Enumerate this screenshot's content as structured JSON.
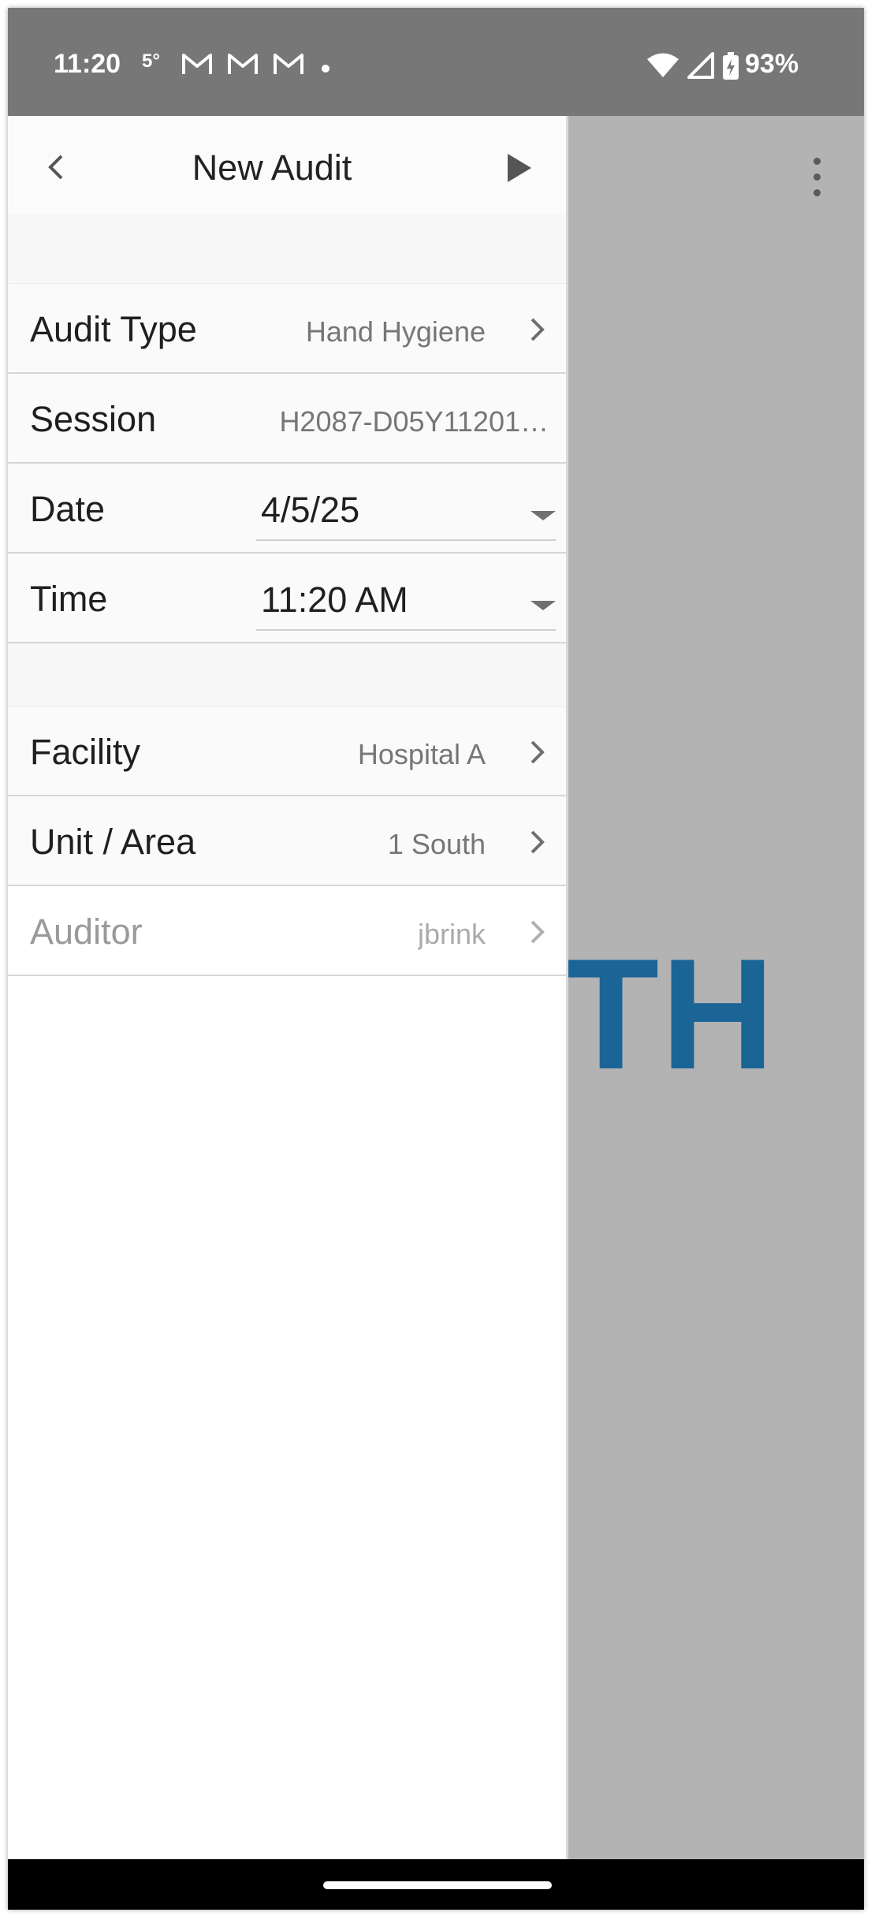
{
  "status_bar": {
    "time": "11:20",
    "temperature": "5°",
    "notification_icons": [
      "gmail-icon",
      "gmail-icon",
      "gmail-icon"
    ],
    "right_icons": [
      "wifi-icon",
      "signal-icon",
      "battery-charging-icon"
    ],
    "battery_percent": "93%"
  },
  "background": {
    "text": "TH",
    "text_color": "#1a6496",
    "menu_icon": "overflow-menu-icon"
  },
  "panel": {
    "title": "New Audit",
    "back_icon": "chevron-left-icon",
    "next_icon": "play-icon",
    "rows": {
      "audit_type": {
        "label": "Audit Type",
        "value": "Hand Hygiene"
      },
      "session": {
        "label": "Session",
        "value": "H2087-D05Y11201…"
      },
      "date": {
        "label": "Date",
        "value": "4/5/25"
      },
      "time": {
        "label": "Time",
        "value": "11:20 AM"
      },
      "facility": {
        "label": "Facility",
        "value": "Hospital A"
      },
      "unit_area": {
        "label": "Unit / Area",
        "value": "1 South"
      },
      "auditor": {
        "label": "Auditor",
        "value": "jbrink"
      }
    }
  },
  "colors": {
    "status_bar": "#777777",
    "scrim": "#b3b3b3",
    "accent_text": "#1a6496"
  }
}
